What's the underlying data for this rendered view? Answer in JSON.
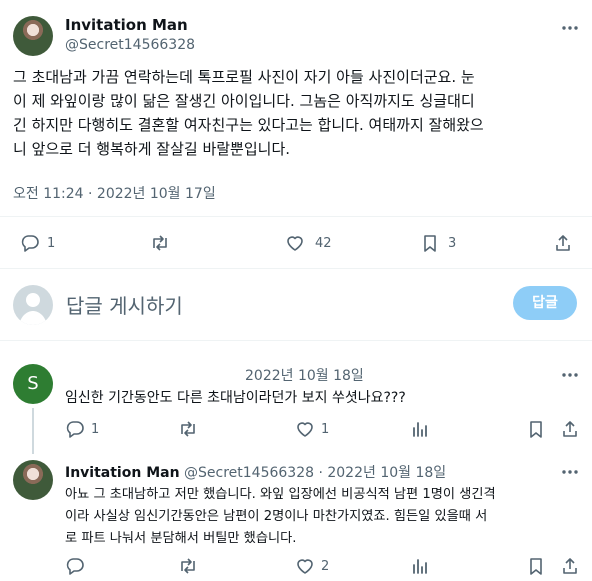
{
  "tweet": {
    "author_name": "Invitation Man",
    "author_handle": "@Secret14566328",
    "text_lines": [
      "그 초대남과 가끔 연락하는데 톡프로필 사진이 자기 아들 사진이더군요. 눈",
      "이 제 와잎이랑 많이 닮은 잘생긴 아이입니다. 그놈은 아직까지도 싱글대디",
      "긴 하지만 다행히도 결혼할 여자친구는 있다고는 합니다. 여태까지 잘해왔으",
      "니 앞으로 더 행복하게 잘살길 바랄뿐입니다."
    ],
    "timestamp": "오전 11:24 · 2022년 10월 17일",
    "replies": "1",
    "likes": "42",
    "bookmarks": "3"
  },
  "reply_box": {
    "placeholder": "답글 게시하기",
    "button_label": "답글"
  },
  "comment1": {
    "avatar_letter": "S",
    "avatar_color": "#2e7d32",
    "date": "2022년 10월 18일",
    "text": "임신한 기간동안도 다른 초대남이라던가 보지 쑤셧나요???",
    "replies": "1",
    "likes": "1"
  },
  "comment2": {
    "author_name": "Invitation Man",
    "meta": "@Secret14566328 · 2022년 10월 18일",
    "text_lines": [
      "아뇨 그 초대남하고 저만 했습니다. 와잎 입장에선 비공식적 남편 1명이 생긴격",
      "이라 사실상 임신기간동안은 남편이 2명이나 마찬가지였죠. 힘든일 있을때 서",
      "로 파트 나눠서 분담해서 버틸만 했습니다."
    ],
    "likes": "2"
  }
}
